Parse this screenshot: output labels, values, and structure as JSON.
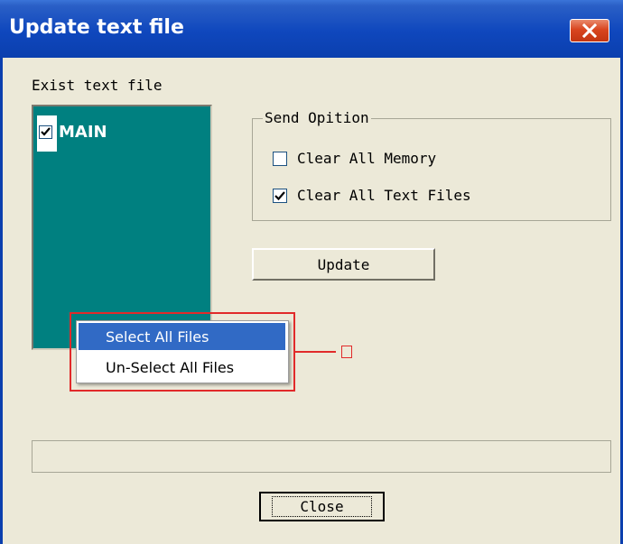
{
  "window": {
    "title": "Update text file"
  },
  "labels": {
    "exist_text_file": "Exist text file"
  },
  "file_list": {
    "items": [
      {
        "name": "MAIN",
        "checked": true
      }
    ],
    "background_color": "#008080"
  },
  "send_option": {
    "legend": "Send Opition",
    "clear_all_memory": {
      "label": "Clear All Memory",
      "checked": false
    },
    "clear_all_text_files": {
      "label": "Clear All Text Files",
      "checked": true
    }
  },
  "buttons": {
    "update": "Update",
    "close": "Close"
  },
  "context_menu": {
    "items": [
      {
        "label": "Select All Files",
        "highlighted": true
      },
      {
        "label": "Un-Select All Files",
        "highlighted": false
      }
    ]
  },
  "progress": {
    "value": 0
  },
  "colors": {
    "annotation": "#e12a2a",
    "menu_highlight": "#316ac5",
    "titlebar": "#0b3fae"
  }
}
